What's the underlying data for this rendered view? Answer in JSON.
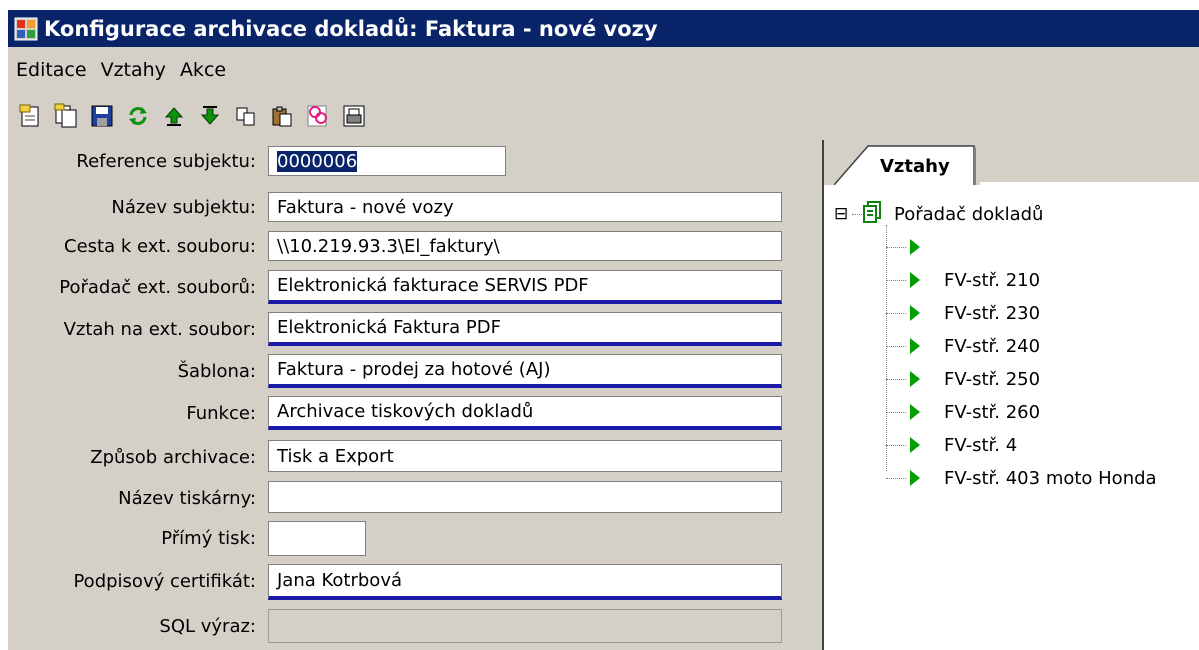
{
  "window": {
    "title": "Konfigurace archivace dokladů: Faktura - nové vozy",
    "icon": "app-window-icon"
  },
  "menu": [
    "Editace",
    "Vztahy",
    "Akce"
  ],
  "toolbar": {
    "icons": [
      "new-document-icon",
      "copy-document-icon",
      "save-icon",
      "refresh-icon",
      "move-up-icon",
      "move-down-icon",
      "copy-icon",
      "paste-icon",
      "link-icon",
      "print-icon"
    ]
  },
  "form": {
    "fields": [
      {
        "label": "Reference subjektu:",
        "value": "0000006"
      },
      {
        "label": "Název subjektu:",
        "value": "Faktura - nové vozy"
      },
      {
        "label": "Cesta k ext. souboru:",
        "value": "\\\\10.219.93.3\\El_faktury\\"
      },
      {
        "label": "Pořadač ext. souborů:",
        "value": "Elektronická fakturace SERVIS PDF"
      },
      {
        "label": "Vztah na ext. soubor:",
        "value": "Elektronická Faktura PDF"
      },
      {
        "label": "Šablona:",
        "value": "Faktura - prodej za hotové (AJ)"
      },
      {
        "label": "Funkce:",
        "value": "Archivace tiskových dokladů"
      },
      {
        "label": "Způsob archivace:",
        "value": "Tisk a Export"
      },
      {
        "label": "Název tiskárny:",
        "value": ""
      },
      {
        "label": "Přímý tisk:",
        "value": ""
      },
      {
        "label": "Podpisový certifikát:",
        "value": "Jana Kotrbová"
      },
      {
        "label": "SQL výraz:",
        "value": ""
      }
    ]
  },
  "relations": {
    "tab_label": "Vztahy",
    "root": "Pořadač dokladů",
    "root_toggle": "⊟",
    "children": [
      "",
      "FV-stř. 210",
      "FV-stř. 230",
      "FV-stř. 240",
      "FV-stř. 250",
      "FV-stř. 260",
      "FV-stř. 4",
      "FV-stř. 403 moto Honda"
    ]
  },
  "colors": {
    "titlebar": "#0a246a",
    "window_bg": "#d4d0c8",
    "required_underline": "#1a1aa8",
    "tree_arrow": "#00a000"
  }
}
